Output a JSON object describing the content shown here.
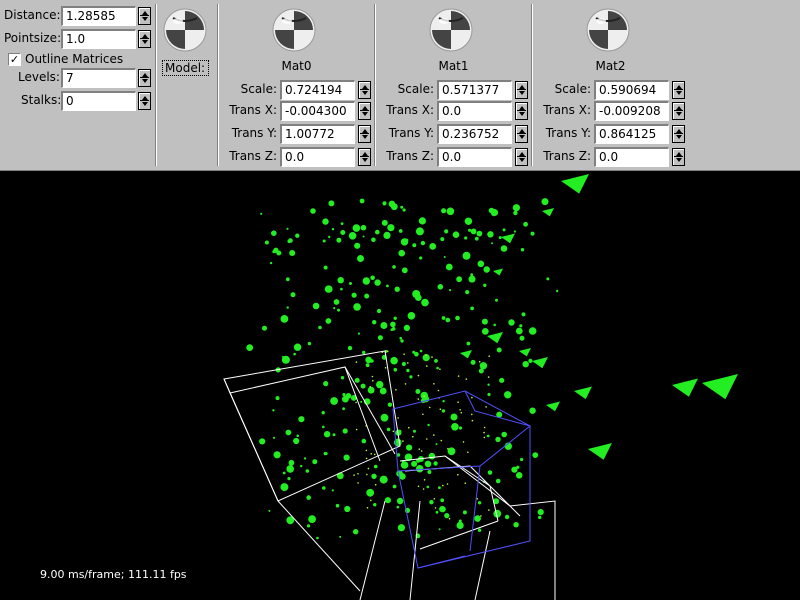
{
  "left_controls": {
    "distance": {
      "label": "Distance:",
      "value": "1.28585"
    },
    "pointsize": {
      "label": "Pointsize:",
      "value": "1.0"
    },
    "outline": {
      "label": "Outline Matrices",
      "checked_glyph": "✓"
    },
    "levels": {
      "label": "Levels:",
      "value": "7"
    },
    "stalks": {
      "label": "Stalks:",
      "value": "0"
    }
  },
  "model": {
    "label": "Model:"
  },
  "matrices": [
    {
      "title": "Mat0",
      "scale_label": "Scale:",
      "scale": "0.724194",
      "tx_label": "Trans X:",
      "tx": "-0.004300",
      "ty_label": "Trans Y:",
      "ty": "1.00772",
      "tz_label": "Trans Z:",
      "tz": "0.0"
    },
    {
      "title": "Mat1",
      "scale_label": "Scale:",
      "scale": "0.571377",
      "tx_label": "Trans X:",
      "tx": "0.0",
      "ty_label": "Trans Y:",
      "ty": "0.236752",
      "tz_label": "Trans Z:",
      "tz": "0.0"
    },
    {
      "title": "Mat2",
      "scale_label": "Scale:",
      "scale": "0.590694",
      "tx_label": "Trans X:",
      "tx": "-0.009208",
      "ty_label": "Trans Y:",
      "ty": "0.864125",
      "tz_label": "Trans Z:",
      "tz": "0.0"
    }
  ],
  "icons": {
    "sphere": "checker-sphere-icon",
    "spinner": "spin-arrows-icon"
  },
  "colors": {
    "panel": "#c0c0c0",
    "points": "#22ee22",
    "outline_white": "#ffffff",
    "outline_blue": "#5050ff"
  },
  "status": {
    "fps": "9.00 ms/frame; 111.11 fps"
  }
}
